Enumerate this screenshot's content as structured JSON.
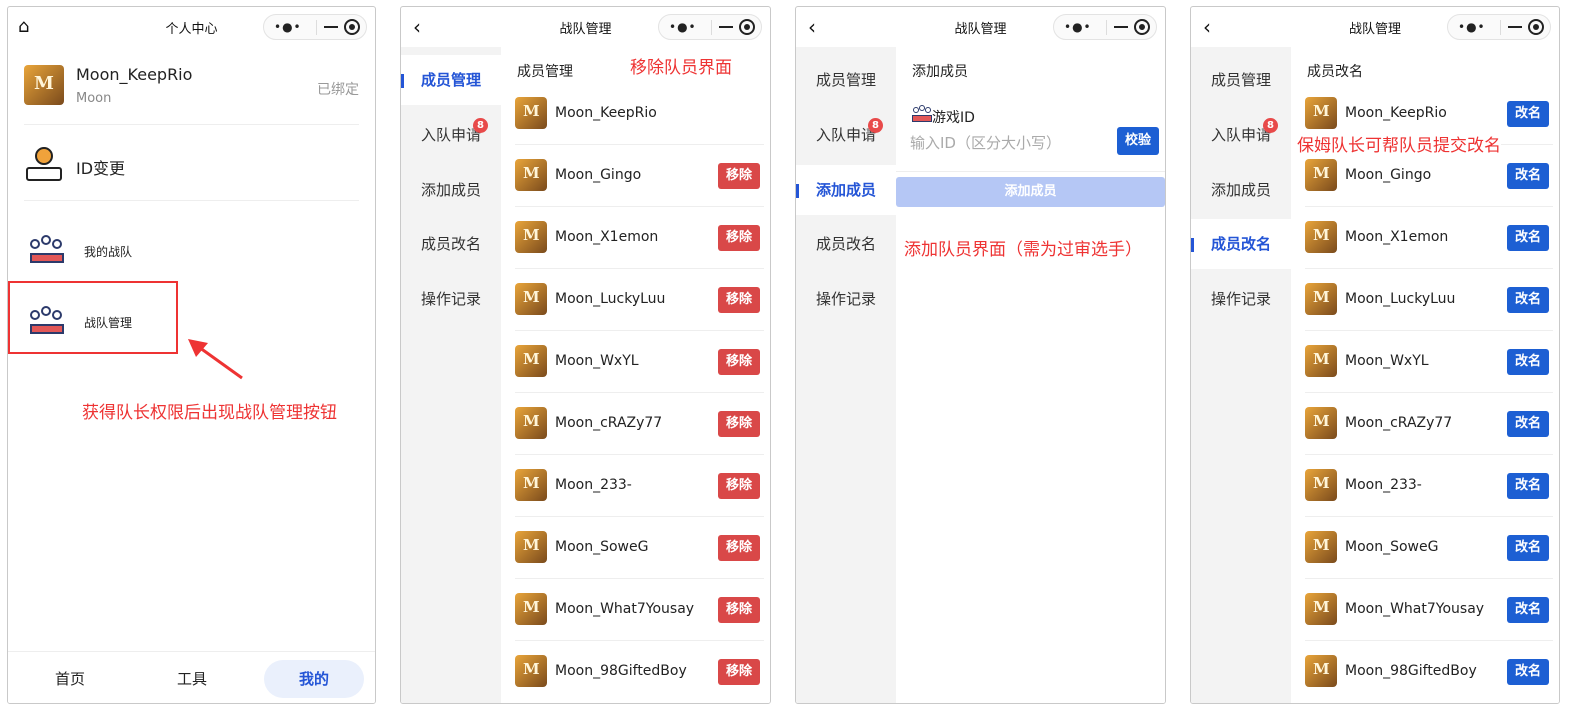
{
  "panel1": {
    "title": "个人中心",
    "profile": {
      "name": "Moon_KeepRio",
      "sub": "Moon",
      "status": "已绑定"
    },
    "id_change": "ID变更",
    "my_team": "我的战队",
    "team_manage": "战队管理",
    "tabs": [
      "首页",
      "工具",
      "我的"
    ],
    "annotation": "获得队长权限后出现战队管理按钮"
  },
  "manage_title": "战队管理",
  "sidebar": {
    "items": [
      "成员管理",
      "入队申请",
      "添加成员",
      "成员改名",
      "操作记录"
    ],
    "badge": "8"
  },
  "panel2": {
    "section_title": "成员管理",
    "annotation": "移除队员界面",
    "remove_label": "移除"
  },
  "panel3": {
    "section_title": "添加成员",
    "field_label": "游戏ID",
    "placeholder": "输入ID（区分大小写）",
    "verify_label": "校验",
    "add_button": "添加成员",
    "annotation": "添加队员界面（需为过审选手）"
  },
  "panel4": {
    "section_title": "成员改名",
    "rename_label": "改名",
    "annotation": "保姆队长可帮队员提交改名"
  },
  "members": [
    "Moon_KeepRio",
    "Moon_Gingo",
    "Moon_X1emon",
    "Moon_LuckyLuu",
    "Moon_WxYL",
    "Moon_cRAZy77",
    "Moon_233-",
    "Moon_SoweG",
    "Moon_What7Yousay",
    "Moon_98GiftedBoy"
  ],
  "colors": {
    "accent": "#2455d6",
    "remove": "#d94848",
    "annotation": "#e33333"
  },
  "icons": {
    "home": "home-icon",
    "back": "back-icon"
  }
}
